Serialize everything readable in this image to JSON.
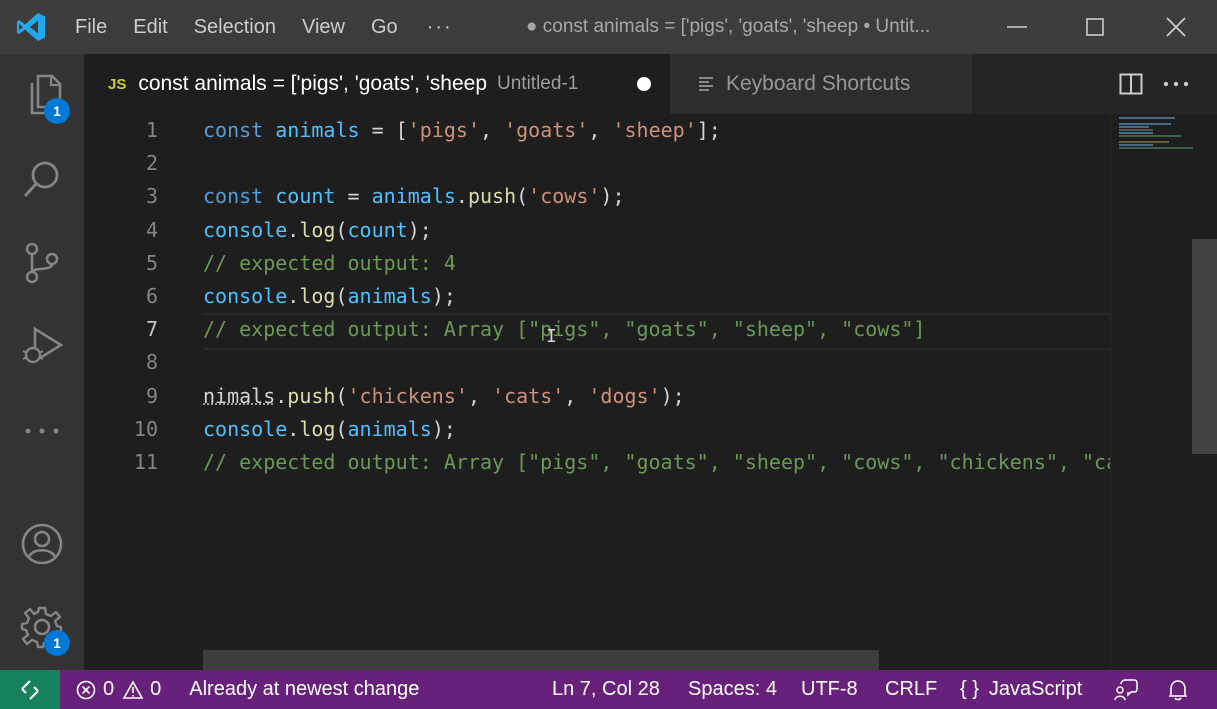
{
  "menu": {
    "file": "File",
    "edit": "Edit",
    "selection": "Selection",
    "view": "View",
    "go": "Go",
    "more": "···"
  },
  "window_title": "● const animals = ['pigs', 'goats', 'sheep • Untit...",
  "activity": {
    "explorer_badge": "1",
    "settings_badge": "1"
  },
  "tabs": {
    "active": {
      "lang_icon": "JS",
      "name": "const animals = ['pigs', 'goats', 'sheep",
      "description": "Untitled-1"
    },
    "inactive": {
      "name": "Keyboard Shortcuts"
    }
  },
  "editor": {
    "line_numbers": [
      "1",
      "2",
      "3",
      "4",
      "5",
      "6",
      "7",
      "8",
      "9",
      "10",
      "11"
    ],
    "current_line": 7,
    "lines": [
      [
        {
          "t": "const",
          "c": "kw"
        },
        {
          "t": " ",
          "c": "pl"
        },
        {
          "t": "animals",
          "c": "var"
        },
        {
          "t": " = [",
          "c": "pl"
        },
        {
          "t": "'pigs'",
          "c": "str"
        },
        {
          "t": ", ",
          "c": "pl"
        },
        {
          "t": "'goats'",
          "c": "str"
        },
        {
          "t": ", ",
          "c": "pl"
        },
        {
          "t": "'sheep'",
          "c": "str"
        },
        {
          "t": "];",
          "c": "pl"
        }
      ],
      [],
      [
        {
          "t": "const",
          "c": "kw"
        },
        {
          "t": " ",
          "c": "pl"
        },
        {
          "t": "count",
          "c": "var"
        },
        {
          "t": " = ",
          "c": "pl"
        },
        {
          "t": "animals",
          "c": "var"
        },
        {
          "t": ".",
          "c": "pl"
        },
        {
          "t": "push",
          "c": "fn"
        },
        {
          "t": "(",
          "c": "pl"
        },
        {
          "t": "'cows'",
          "c": "str"
        },
        {
          "t": ");",
          "c": "pl"
        }
      ],
      [
        {
          "t": "console",
          "c": "var"
        },
        {
          "t": ".",
          "c": "pl"
        },
        {
          "t": "log",
          "c": "fn"
        },
        {
          "t": "(",
          "c": "pl"
        },
        {
          "t": "count",
          "c": "var"
        },
        {
          "t": ");",
          "c": "pl"
        }
      ],
      [
        {
          "t": "// expected output: 4",
          "c": "cm"
        }
      ],
      [
        {
          "t": "console",
          "c": "var"
        },
        {
          "t": ".",
          "c": "pl"
        },
        {
          "t": "log",
          "c": "fn"
        },
        {
          "t": "(",
          "c": "pl"
        },
        {
          "t": "animals",
          "c": "var"
        },
        {
          "t": ");",
          "c": "pl"
        }
      ],
      [
        {
          "t": "// expected output: Array [\"pigs\", \"goats\", \"sheep\", \"cows\"]",
          "c": "cm"
        }
      ],
      [],
      [
        {
          "t": "nimals",
          "c": "pl squig"
        },
        {
          "t": ".",
          "c": "pl"
        },
        {
          "t": "push",
          "c": "fn"
        },
        {
          "t": "(",
          "c": "pl"
        },
        {
          "t": "'chickens'",
          "c": "str"
        },
        {
          "t": ", ",
          "c": "pl"
        },
        {
          "t": "'cats'",
          "c": "str"
        },
        {
          "t": ", ",
          "c": "pl"
        },
        {
          "t": "'dogs'",
          "c": "str"
        },
        {
          "t": ");",
          "c": "pl"
        }
      ],
      [
        {
          "t": "console",
          "c": "var"
        },
        {
          "t": ".",
          "c": "pl"
        },
        {
          "t": "log",
          "c": "fn"
        },
        {
          "t": "(",
          "c": "pl"
        },
        {
          "t": "animals",
          "c": "var"
        },
        {
          "t": ");",
          "c": "pl"
        }
      ],
      [
        {
          "t": "// expected output: Array [\"pigs\", \"goats\", \"sheep\", \"cows\", \"chickens\", \"cats\", \"dogs\"]",
          "c": "cm"
        }
      ]
    ]
  },
  "status": {
    "errors": "0",
    "warnings": "0",
    "message": "Already at newest change",
    "position": "Ln 7, Col 28",
    "spaces": "Spaces: 4",
    "encoding": "UTF-8",
    "eol": "CRLF",
    "language_icon": "{ }",
    "language": "JavaScript"
  },
  "colors": {
    "statusbar": "#68217a",
    "remote": "#16825d",
    "accent": "#0078d4"
  }
}
